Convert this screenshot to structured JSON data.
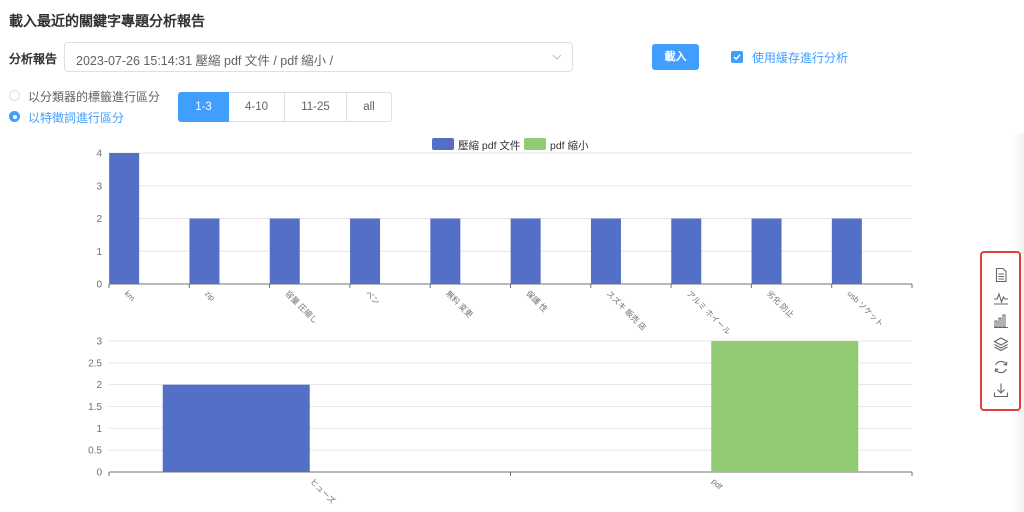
{
  "header": {
    "title": "載入最近的關鍵字專題分析報告"
  },
  "report": {
    "label": "分析報告",
    "selected": "2023-07-26 15:14:31 壓縮 pdf 文件 / pdf 縮小 /",
    "load_button": "載入",
    "cache_label": "使用緩存進行分析",
    "cache_checked": true
  },
  "grouping": {
    "options": [
      {
        "label": "以分類器的標籤進行區分",
        "selected": false
      },
      {
        "label": "以特徵詞進行區分",
        "selected": true
      }
    ]
  },
  "ranges": {
    "buttons": [
      "1-3",
      "4-10",
      "11-25",
      "all"
    ],
    "active": "1-3"
  },
  "legend": {
    "items": [
      {
        "label": "壓縮 pdf 文件",
        "color": "#5470c6"
      },
      {
        "label": "pdf 縮小",
        "color": "#91cc75"
      }
    ]
  },
  "chart_data": [
    {
      "type": "bar",
      "categories": [
        "km",
        "zip",
        "容量 圧縮し",
        "ベン",
        "無料 変更",
        "保護 性",
        "スズキ 販売 店",
        "アルミ ホイール",
        "劣化 防止",
        "usb ソケット"
      ],
      "series": [
        {
          "name": "壓縮 pdf 文件",
          "values": [
            4,
            2,
            2,
            2,
            2,
            2,
            2,
            2,
            2,
            2
          ],
          "color": "#5470c6"
        },
        {
          "name": "pdf 縮小",
          "values": [
            0,
            0,
            0,
            0,
            0,
            0,
            0,
            0,
            0,
            0
          ],
          "color": "#91cc75"
        }
      ],
      "ylim": [
        0,
        4
      ],
      "yticks": [
        "0",
        "1",
        "2",
        "3",
        "4"
      ],
      "grid": true
    },
    {
      "type": "bar",
      "categories": [
        "ヒューズ",
        "pdf"
      ],
      "series": [
        {
          "name": "壓縮 pdf 文件",
          "values": [
            2,
            0
          ],
          "color": "#5470c6"
        },
        {
          "name": "pdf 縮小",
          "values": [
            0,
            3
          ],
          "color": "#91cc75"
        }
      ],
      "ylim": [
        0,
        3
      ],
      "yticks": [
        "0",
        "0.5",
        "1",
        "1.5",
        "2",
        "2.5",
        "3"
      ],
      "grid": true
    }
  ],
  "toolbox": {
    "icons": [
      "data-view-icon",
      "line-chart-icon",
      "bar-chart-icon",
      "stack-icon",
      "restore-icon",
      "download-icon"
    ]
  }
}
